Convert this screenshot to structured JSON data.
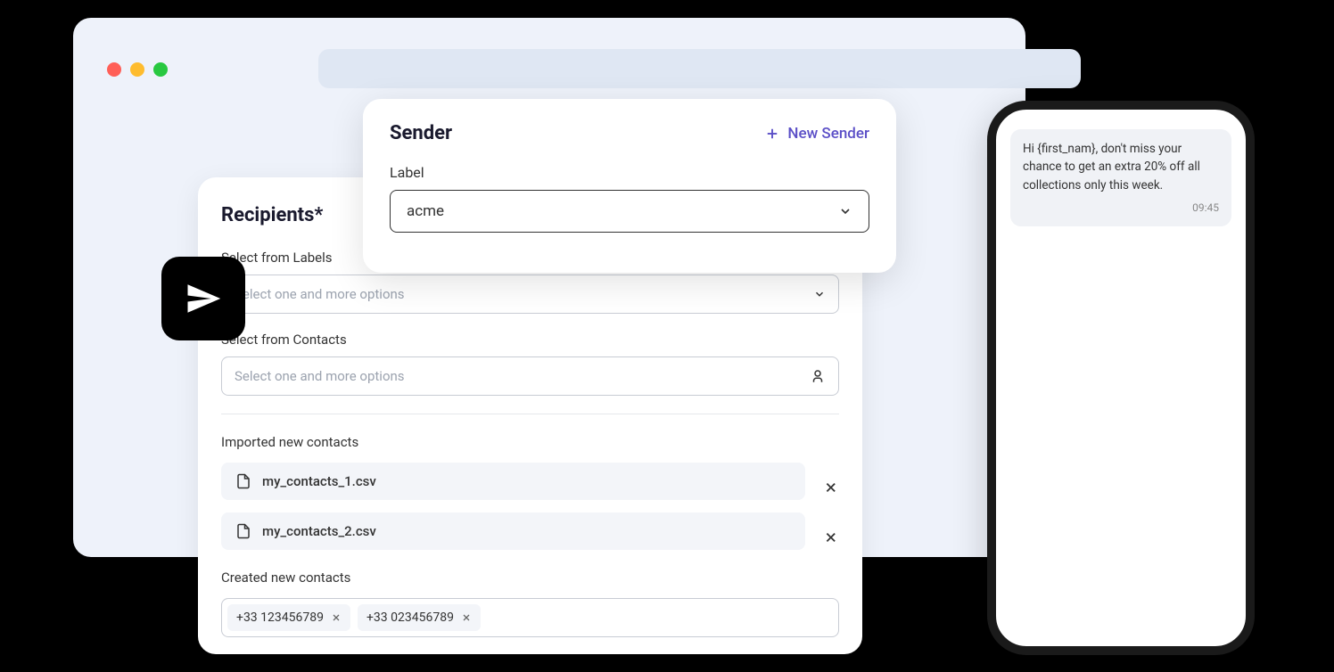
{
  "recipients": {
    "title": "Recipients*",
    "labels_label": "Select from Labels",
    "labels_placeholder": "Select one and more options",
    "contacts_label": "Select from Contacts",
    "contacts_placeholder": "Select one and more options",
    "imported_label": "Imported new contacts",
    "files": [
      {
        "name": "my_contacts_1.csv"
      },
      {
        "name": "my_contacts_2.csv"
      }
    ],
    "created_label": "Created new contacts",
    "tags": [
      {
        "value": "+33 123456789"
      },
      {
        "value": "+33 023456789"
      }
    ]
  },
  "sender": {
    "title": "Sender",
    "new_sender_label": "New Sender",
    "field_label": "Label",
    "selected_value": "acme"
  },
  "phone": {
    "message": "Hi {first_nam}, don't miss your chance to get an extra 20% off all collections only this week.",
    "time": "09:45"
  }
}
